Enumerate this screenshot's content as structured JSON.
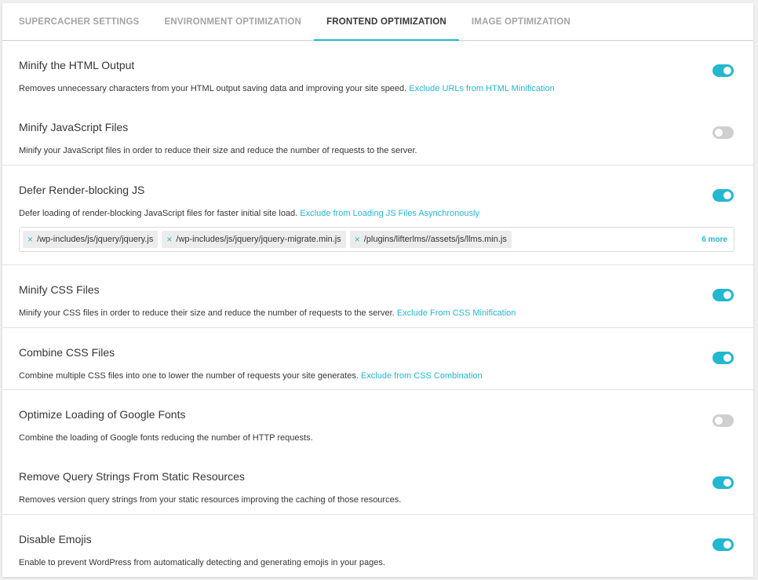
{
  "tabs": [
    {
      "label": "SUPERCACHER SETTINGS",
      "active": false
    },
    {
      "label": "ENVIRONMENT OPTIMIZATION",
      "active": false
    },
    {
      "label": "FRONTEND OPTIMIZATION",
      "active": true
    },
    {
      "label": "IMAGE OPTIMIZATION",
      "active": false
    }
  ],
  "colors": {
    "accent": "#22b8cf",
    "toggle_off": "#cfcfcf",
    "text": "#363636"
  },
  "settings": [
    {
      "title": "Minify the HTML Output",
      "description": "Removes unnecessary characters from your HTML output saving data and improving your site speed.",
      "link": "Exclude URLs from HTML Minification",
      "enabled": true
    },
    {
      "title": "Minify JavaScript Files",
      "description": "Minify your JavaScript files in order to reduce their size and reduce the number of requests to the server.",
      "link": "",
      "enabled": false
    },
    {
      "title": "Defer Render-blocking JS",
      "description": "Defer loading of render-blocking JavaScript files for faster initial site load.",
      "link": "Exclude from Loading JS Files Asynchronously",
      "enabled": true,
      "exclusions": [
        "/wp-includes/js/jquery/jquery.js",
        "/wp-includes/js/jquery/jquery-migrate.min.js",
        "/plugins/lifterlms//assets/js/llms.min.js"
      ],
      "more_label": "6 more"
    },
    {
      "title": "Minify CSS Files",
      "description": "Minify your CSS files in order to reduce their size and reduce the number of requests to the server.",
      "link": "Exclude From CSS Minification",
      "enabled": true
    },
    {
      "title": "Combine CSS Files",
      "description": "Combine multiple CSS files into one to lower the number of requests your site generates.",
      "link": "Exclude from CSS Combination",
      "enabled": true
    },
    {
      "title": "Optimize Loading of Google Fonts",
      "description": "Combine the loading of Google fonts reducing the number of HTTP requests.",
      "link": "",
      "enabled": false
    },
    {
      "title": "Remove Query Strings From Static Resources",
      "description": "Removes version query strings from your static resources improving the caching of those resources.",
      "link": "",
      "enabled": true
    },
    {
      "title": "Disable Emojis",
      "description": "Enable to prevent WordPress from automatically detecting and generating emojis in your pages.",
      "link": "",
      "enabled": true
    }
  ]
}
